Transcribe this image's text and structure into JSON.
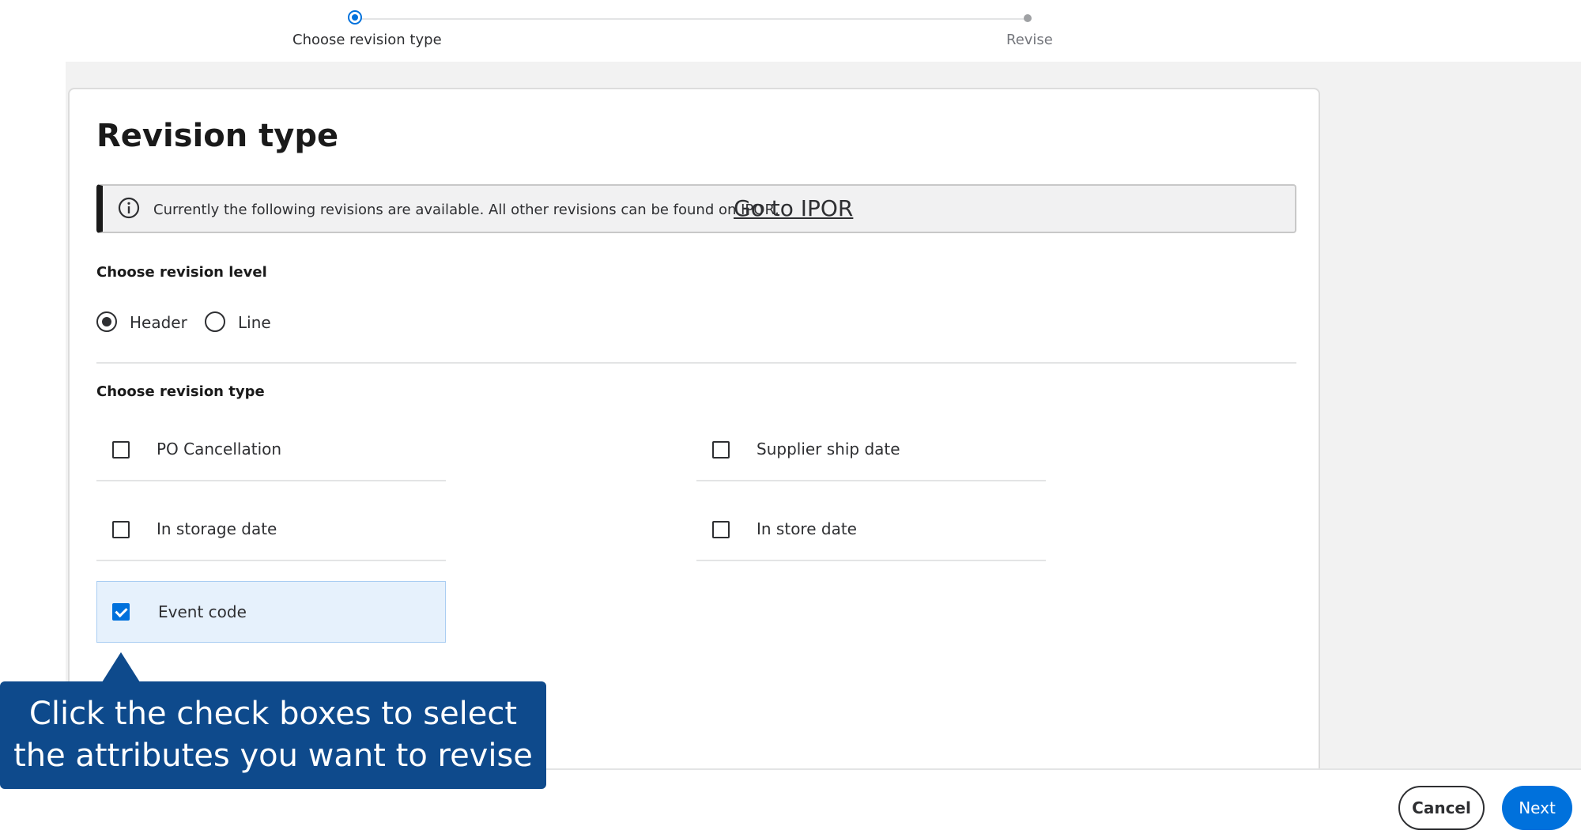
{
  "stepper": {
    "steps": [
      {
        "label": "Choose revision type",
        "state": "active"
      },
      {
        "label": "Revise",
        "state": "upcoming"
      }
    ]
  },
  "card": {
    "title": "Revision type",
    "alert": {
      "icon": "info-icon",
      "text": "Currently the following revisions are available. All other revisions can be found on IPOR,",
      "link": "Go to IPOR"
    },
    "revision_level": {
      "label": "Choose revision level",
      "options": [
        {
          "label": "Header",
          "checked": true
        },
        {
          "label": "Line",
          "checked": false
        }
      ]
    },
    "revision_type": {
      "label": "Choose revision type",
      "options": [
        {
          "label": "PO Cancellation",
          "checked": false
        },
        {
          "label": "Supplier ship date",
          "checked": false
        },
        {
          "label": "In storage date",
          "checked": false
        },
        {
          "label": "In store date",
          "checked": false
        },
        {
          "label": "Event code",
          "checked": true
        }
      ]
    }
  },
  "callout": {
    "line1": "Click the check boxes to select",
    "line2": "the attributes you want to revise"
  },
  "footer": {
    "cancel_label": "Cancel",
    "next_label": "Next"
  },
  "colors": {
    "primary": "#0071dc",
    "callout_bg": "#0e4a8c",
    "selected_row_bg": "#e6f1fc",
    "canvas_bg": "#f2f2f2"
  }
}
